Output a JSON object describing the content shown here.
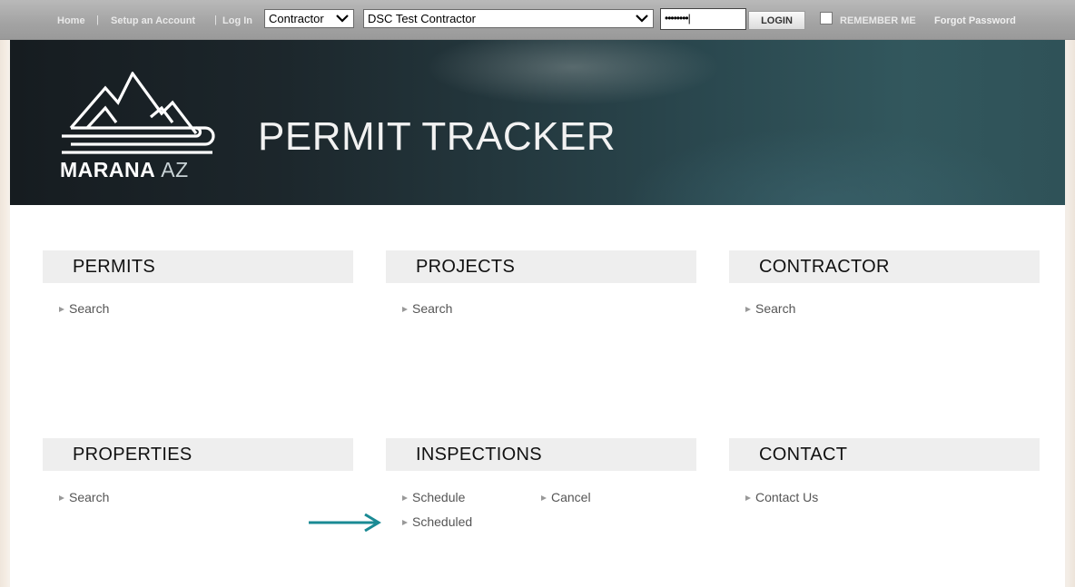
{
  "topbar": {
    "home": "Home",
    "setup": "Setup an Account",
    "login_link": "Log In",
    "separator": "|",
    "account_type": "Contractor",
    "contractor_name": "DSC Test Contractor",
    "password_mask": "••••••••",
    "login_button": "LOGIN",
    "remember_me": "REMEMBER ME",
    "forgot_password": "Forgot Password"
  },
  "banner": {
    "logo_main": "MARANA",
    "logo_az": "AZ",
    "title": "PERMIT TRACKER"
  },
  "panels": {
    "permits": {
      "title": "PERMITS",
      "links": [
        "Search"
      ]
    },
    "projects": {
      "title": "PROJECTS",
      "links": [
        "Search"
      ]
    },
    "contractor": {
      "title": "CONTRACTOR",
      "links": [
        "Search"
      ]
    },
    "properties": {
      "title": "PROPERTIES",
      "links": [
        "Search"
      ]
    },
    "inspections": {
      "title": "INSPECTIONS",
      "links": [
        "Schedule",
        "Cancel",
        "Scheduled"
      ]
    },
    "contact": {
      "title": "CONTACT",
      "links": [
        "Contact Us"
      ]
    }
  },
  "colors": {
    "annotation_arrow": "#1a8a94",
    "banner_dark": "#161c20",
    "banner_teal": "#32575d"
  }
}
